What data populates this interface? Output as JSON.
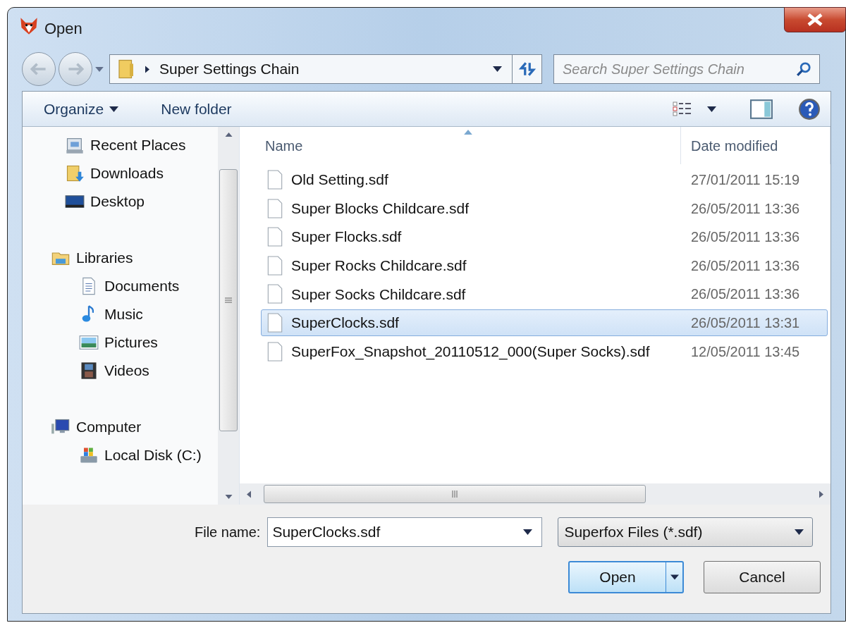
{
  "window": {
    "title": "Open"
  },
  "address": {
    "path": "Super Settings Chain"
  },
  "search": {
    "placeholder": "Search Super Settings Chain"
  },
  "toolbar": {
    "organize": "Organize",
    "new_folder": "New folder"
  },
  "sidebar": {
    "tree": [
      {
        "children": [
          {
            "label": "Recent Places",
            "kind": "recent"
          },
          {
            "label": "Downloads",
            "kind": "downloads"
          },
          {
            "label": "Desktop",
            "kind": "desktop"
          }
        ]
      },
      {
        "label": "Libraries",
        "kind": "libraries",
        "children": [
          {
            "label": "Documents",
            "kind": "documents"
          },
          {
            "label": "Music",
            "kind": "music"
          },
          {
            "label": "Pictures",
            "kind": "pictures"
          },
          {
            "label": "Videos",
            "kind": "videos"
          }
        ]
      },
      {
        "label": "Computer",
        "kind": "computer",
        "children": [
          {
            "label": "Local Disk (C:)",
            "kind": "disk"
          }
        ]
      }
    ]
  },
  "table": {
    "columns": [
      "Name",
      "Date modified"
    ],
    "rows": [
      {
        "name": "Old Setting.sdf",
        "date": "27/01/2011 15:19",
        "selected": false
      },
      {
        "name": "Super Blocks Childcare.sdf",
        "date": "26/05/2011 13:36",
        "selected": false
      },
      {
        "name": "Super Flocks.sdf",
        "date": "26/05/2011 13:36",
        "selected": false
      },
      {
        "name": "Super Rocks Childcare.sdf",
        "date": "26/05/2011 13:36",
        "selected": false
      },
      {
        "name": "Super Socks Childcare.sdf",
        "date": "26/05/2011 13:36",
        "selected": false
      },
      {
        "name": "SuperClocks.sdf",
        "date": "26/05/2011 13:31",
        "selected": true
      },
      {
        "name": "SuperFox_Snapshot_20110512_000(Super Socks).sdf",
        "date": "12/05/2011 13:45",
        "selected": false
      }
    ]
  },
  "footer": {
    "file_name_label": "File name:",
    "file_name": "SuperClocks.sdf",
    "filter": "Superfox Files (*.sdf)",
    "open": "Open",
    "cancel": "Cancel"
  }
}
